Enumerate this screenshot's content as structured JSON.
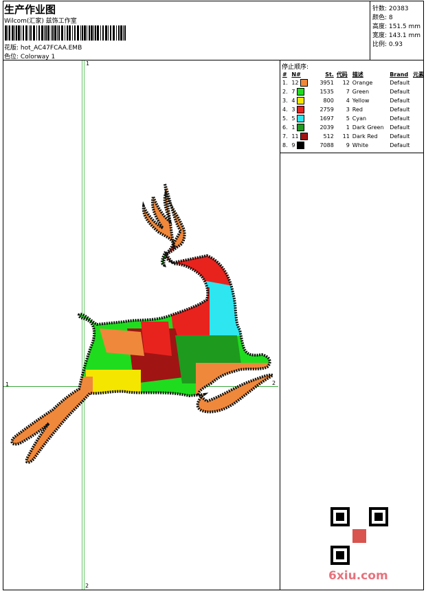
{
  "header": {
    "title": "生产作业图",
    "studio": "Wilcom(汇家) 兹饰工作室",
    "design_label": "花版:",
    "design_value": "hot_AC47FCAA.EMB",
    "colorway_label": "色位:",
    "colorway_value": "Colorway 1"
  },
  "stats": {
    "stitches": "针数: 20383",
    "colors": "颜色: 8",
    "height": "高度: 151.5 mm",
    "width": "宽度: 143.1 mm",
    "ratio": "比例: 0.93"
  },
  "stop_order": {
    "title": "停止顺序:",
    "columns": [
      "#",
      "N#",
      "St.",
      "代码",
      "描述",
      "Brand",
      "元素"
    ],
    "rows": [
      {
        "idx": "1.",
        "n": "12",
        "color": "#f0883c",
        "st": "3951",
        "code": "12",
        "desc": "Orange",
        "brand": "Default"
      },
      {
        "idx": "2.",
        "n": "7",
        "color": "#1fdc1f",
        "st": "1535",
        "code": "7",
        "desc": "Green",
        "brand": "Default"
      },
      {
        "idx": "3.",
        "n": "4",
        "color": "#f5e600",
        "st": "800",
        "code": "4",
        "desc": "Yellow",
        "brand": "Default"
      },
      {
        "idx": "4.",
        "n": "3",
        "color": "#e8231e",
        "st": "2759",
        "code": "3",
        "desc": "Red",
        "brand": "Default"
      },
      {
        "idx": "5.",
        "n": "5",
        "color": "#2ee6f0",
        "st": "1697",
        "code": "5",
        "desc": "Cyan",
        "brand": "Default"
      },
      {
        "idx": "6.",
        "n": "1",
        "color": "#1e9a1e",
        "st": "2039",
        "code": "1",
        "desc": "Dark Green",
        "brand": "Default"
      },
      {
        "idx": "7.",
        "n": "11",
        "color": "#a01414",
        "st": "512",
        "code": "11",
        "desc": "Dark Red",
        "brand": "Default"
      },
      {
        "idx": "8.",
        "n": "9",
        "color": "#000000",
        "st": "7088",
        "code": "9",
        "desc": "White",
        "brand": "Default"
      }
    ]
  },
  "canvas": {
    "label_top": "1",
    "label_bottom": "2",
    "label_left": "1",
    "label_right": "2"
  },
  "watermark": "6xiu.com"
}
